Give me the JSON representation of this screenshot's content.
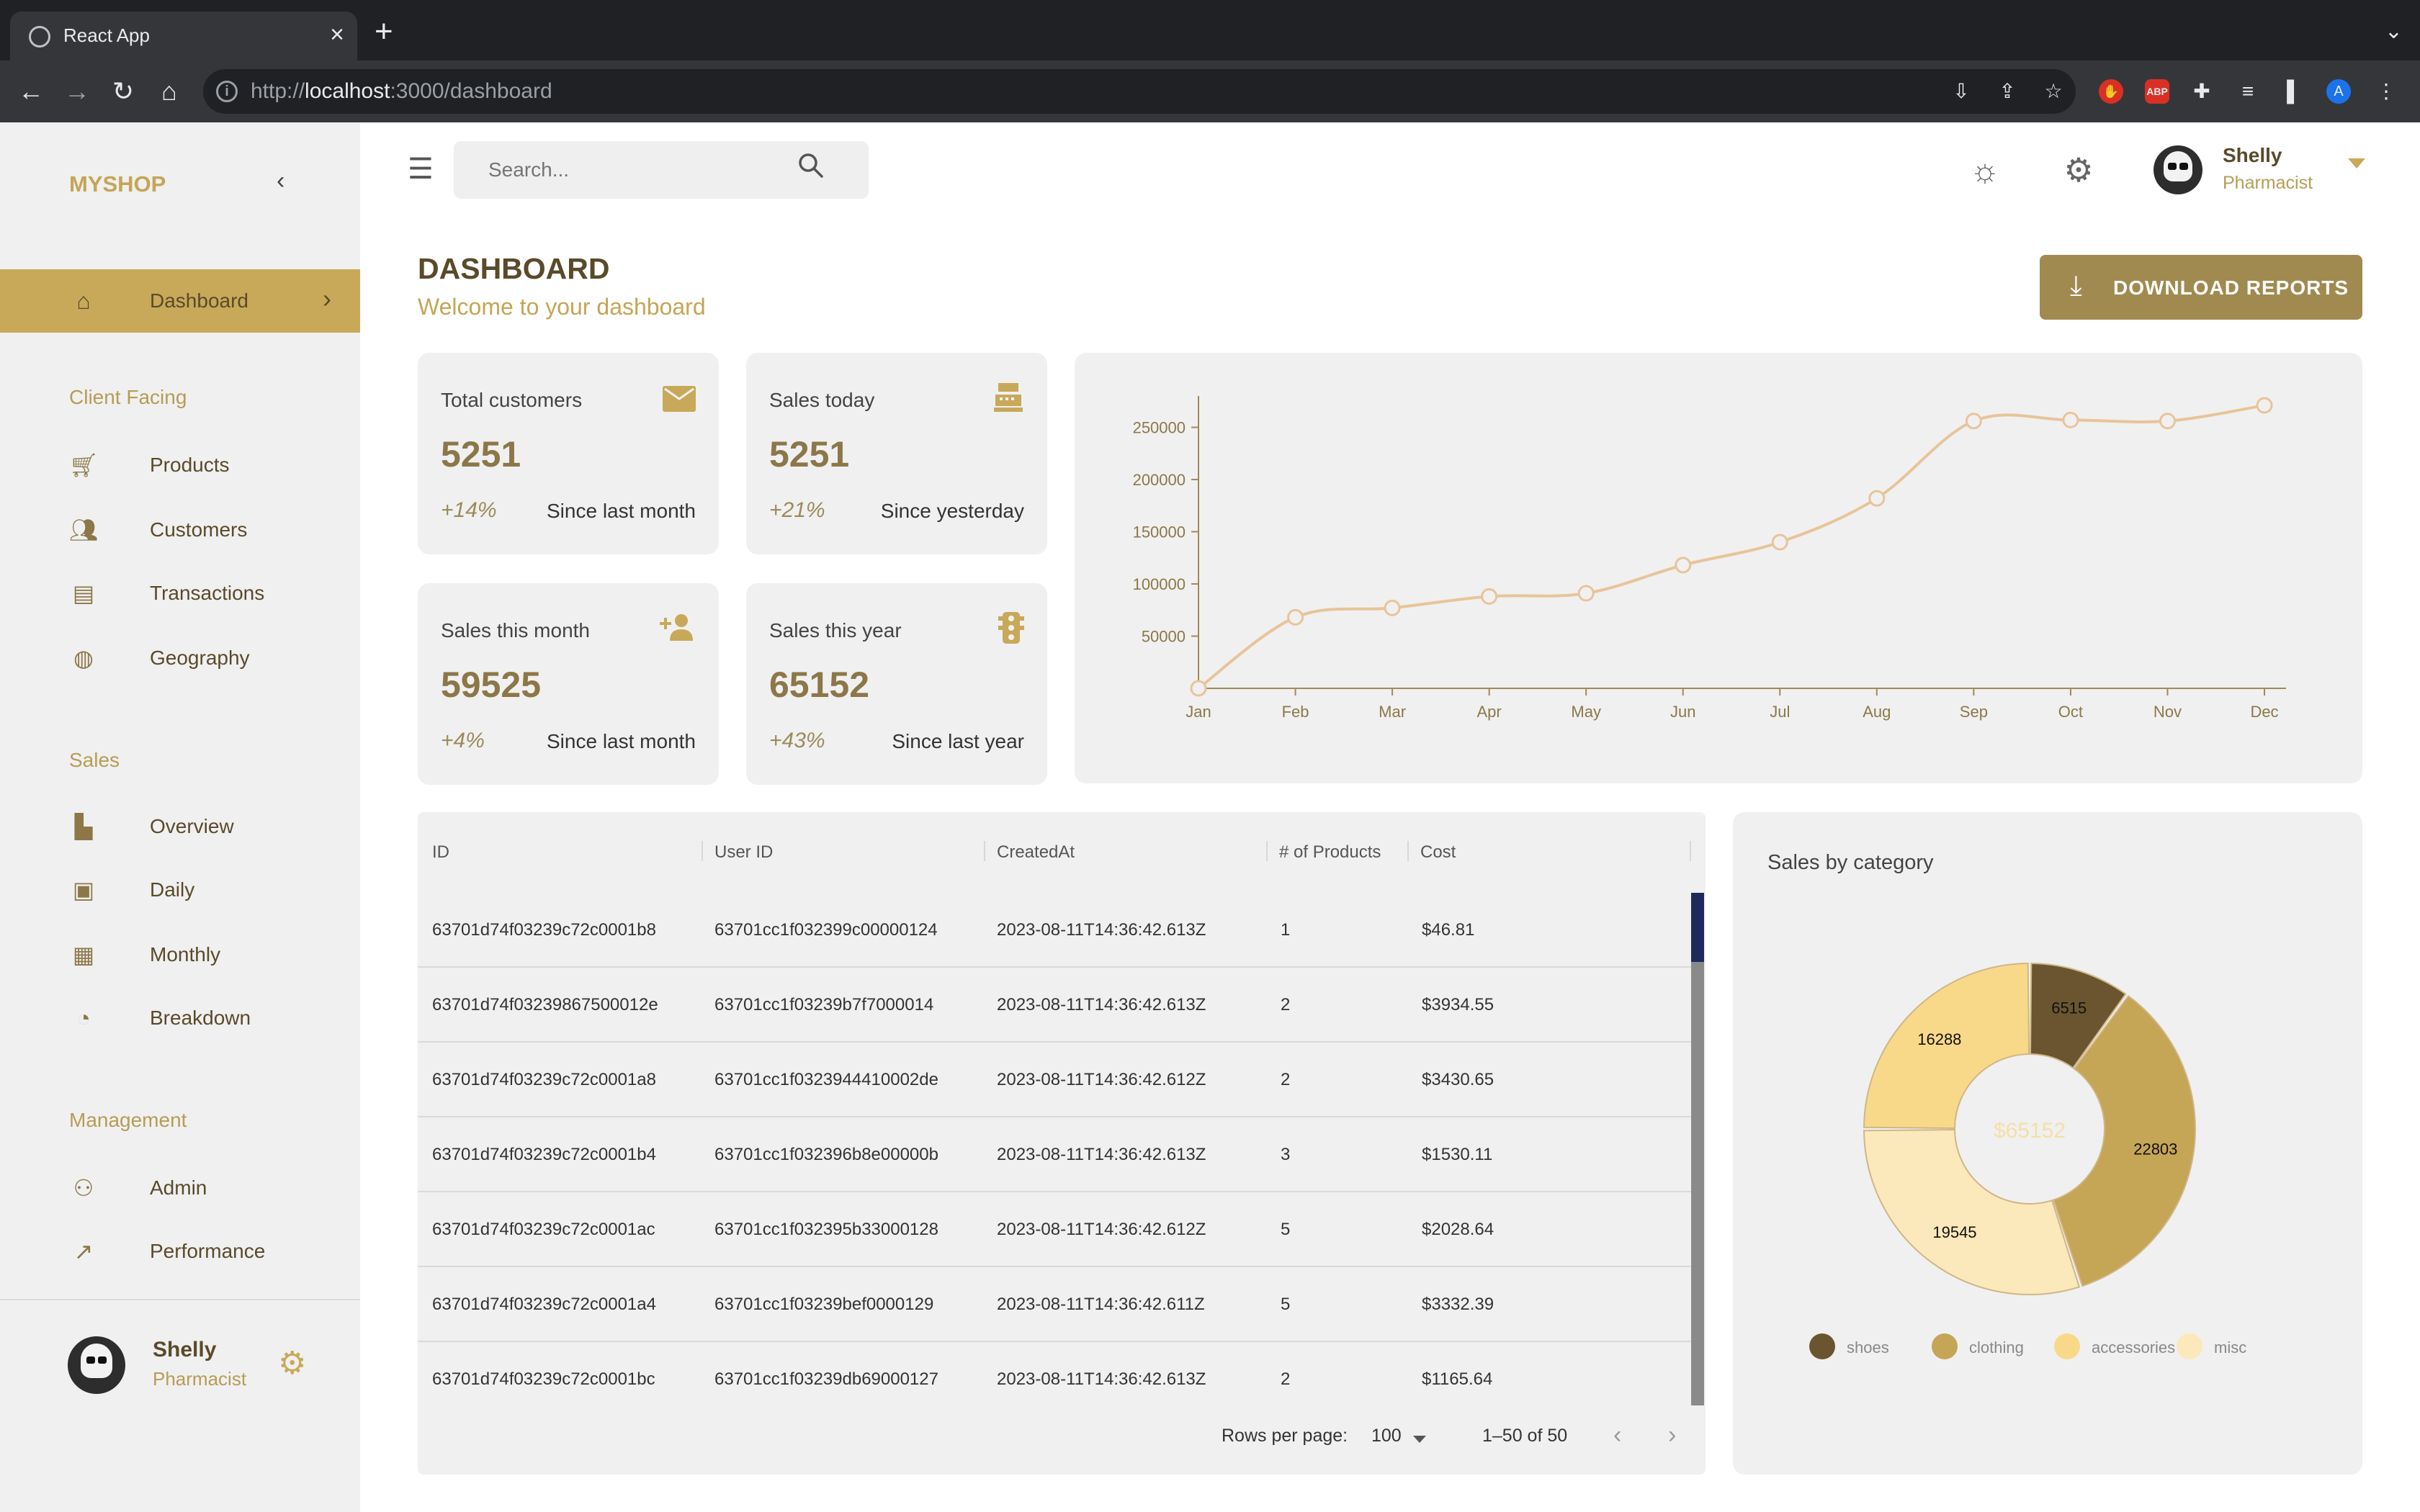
{
  "browser": {
    "tab_title": "React App",
    "url_host": "localhost",
    "url_prefix": "http://",
    "url_rest": ":3000/dashboard"
  },
  "sidebar": {
    "brand": "MYSHOP",
    "active_item": "Dashboard",
    "sections": [
      {
        "title": "Client Facing",
        "items": [
          "Products",
          "Customers",
          "Transactions",
          "Geography"
        ]
      },
      {
        "title": "Sales",
        "items": [
          "Overview",
          "Daily",
          "Monthly",
          "Breakdown"
        ]
      },
      {
        "title": "Management",
        "items": [
          "Admin",
          "Performance"
        ]
      }
    ],
    "user": {
      "name": "Shelly",
      "role": "Pharmacist"
    }
  },
  "topbar": {
    "search_placeholder": "Search...",
    "user": {
      "name": "Shelly",
      "role": "Pharmacist"
    }
  },
  "header": {
    "title": "DASHBOARD",
    "subtitle": "Welcome to your dashboard",
    "download_label": "DOWNLOAD REPORTS"
  },
  "stats": [
    {
      "title": "Total customers",
      "value": "5251",
      "increase": "+14%",
      "description": "Since last month",
      "icon": "email-icon"
    },
    {
      "title": "Sales today",
      "value": "5251",
      "increase": "+21%",
      "description": "Since yesterday",
      "icon": "point-of-sale-icon"
    },
    {
      "title": "Sales this month",
      "value": "59525",
      "increase": "+4%",
      "description": "Since last month",
      "icon": "person-add-icon"
    },
    {
      "title": "Sales this year",
      "value": "65152",
      "increase": "+43%",
      "description": "Since last year",
      "icon": "traffic-icon"
    }
  ],
  "line_chart": {
    "type": "line",
    "categories": [
      "Jan",
      "Feb",
      "Mar",
      "Apr",
      "May",
      "Jun",
      "Jul",
      "Aug",
      "Sep",
      "Oct",
      "Nov",
      "Dec"
    ],
    "values": [
      0,
      68000,
      77000,
      88000,
      91000,
      118000,
      140000,
      182000,
      256000,
      257000,
      256000,
      271000
    ],
    "y_ticks": [
      50000,
      100000,
      150000,
      200000,
      250000
    ],
    "ylim": [
      0,
      280000
    ],
    "color": "#e8c49a"
  },
  "table": {
    "columns": [
      "ID",
      "User ID",
      "CreatedAt",
      "# of Products",
      "Cost"
    ],
    "rows": [
      [
        "63701d74f03239c72c0001b8",
        "63701cc1f032399c00000124",
        "2023-08-11T14:36:42.613Z",
        "1",
        "$46.81"
      ],
      [
        "63701d74f03239867500012e",
        "63701cc1f03239b7f7000014",
        "2023-08-11T14:36:42.613Z",
        "2",
        "$3934.55"
      ],
      [
        "63701d74f03239c72c0001a8",
        "63701cc1f0323944410002de",
        "2023-08-11T14:36:42.612Z",
        "2",
        "$3430.65"
      ],
      [
        "63701d74f03239c72c0001b4",
        "63701cc1f032396b8e00000b",
        "2023-08-11T14:36:42.613Z",
        "3",
        "$1530.11"
      ],
      [
        "63701d74f03239c72c0001ac",
        "63701cc1f032395b33000128",
        "2023-08-11T14:36:42.612Z",
        "5",
        "$2028.64"
      ],
      [
        "63701d74f03239c72c0001a4",
        "63701cc1f03239bef0000129",
        "2023-08-11T14:36:42.611Z",
        "5",
        "$3332.39"
      ],
      [
        "63701d74f03239c72c0001bc",
        "63701cc1f03239db69000127",
        "2023-08-11T14:36:42.613Z",
        "2",
        "$1165.64"
      ]
    ],
    "footer": {
      "rows_per_page_label": "Rows per page:",
      "rows_per_page": "100",
      "range": "1–50 of 50"
    }
  },
  "pie": {
    "title": "Sales by category",
    "total": "$65152",
    "slices": [
      {
        "label": "shoes",
        "value": 6515,
        "color": "#6b5530"
      },
      {
        "label": "clothing",
        "value": 22803,
        "color": "#c5a556"
      },
      {
        "label": "accessories",
        "value": 19545,
        "color": "#fbe8bb"
      },
      {
        "label": "misc",
        "value": 16288,
        "color": "#f8d98a"
      }
    ],
    "legend": [
      {
        "label": "shoes",
        "color": "#6b5530"
      },
      {
        "label": "clothing",
        "color": "#c5a556"
      },
      {
        "label": "accessories",
        "color": "#f8d98a"
      },
      {
        "label": "misc",
        "color": "#fbe8bb"
      }
    ]
  },
  "chart_data": [
    {
      "type": "line",
      "categories": [
        "Jan",
        "Feb",
        "Mar",
        "Apr",
        "May",
        "Jun",
        "Jul",
        "Aug",
        "Sep",
        "Oct",
        "Nov",
        "Dec"
      ],
      "values": [
        0,
        68000,
        77000,
        88000,
        91000,
        118000,
        140000,
        182000,
        256000,
        257000,
        256000,
        271000
      ],
      "ylim": [
        0,
        280000
      ]
    },
    {
      "type": "pie",
      "title": "Sales by category",
      "categories": [
        "shoes",
        "clothing",
        "accessories",
        "misc"
      ],
      "values": [
        6515,
        22803,
        19545,
        16288
      ]
    }
  ]
}
